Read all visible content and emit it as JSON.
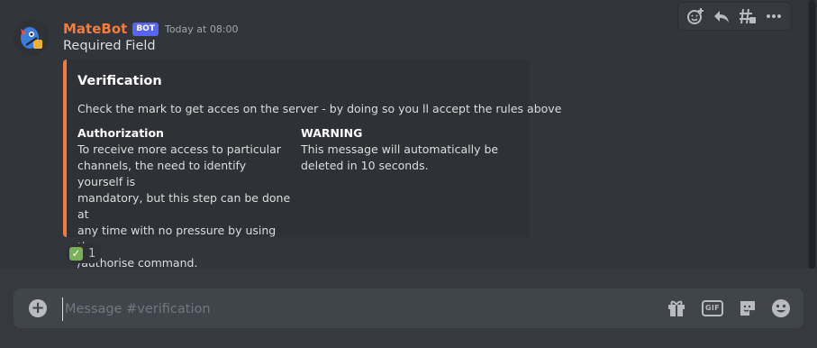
{
  "message": {
    "author": "MateBot",
    "bot_tag": "BOT",
    "timestamp": "Today at 08:00",
    "content": "Required Field"
  },
  "embed": {
    "accent_color": "#f47b3b",
    "title": "Verification",
    "description": "Check the mark to get acces on the server - by doing so you ll accept the rules above",
    "fields": [
      {
        "name": "Authorization",
        "value_lines": [
          "To receive more access to particular",
          "channels, the need to identify yourself is",
          "mandatory, but this step can be done at",
          "any time with no pressure by using the",
          "/authorise command."
        ]
      },
      {
        "name": "WARNING",
        "value_lines": [
          "This message will automatically be",
          "deleted in 10 seconds."
        ]
      }
    ]
  },
  "reaction": {
    "emoji": "white-check-mark",
    "glyph": "✓",
    "count": "1"
  },
  "toolbar": {
    "icons": [
      "add-reaction-icon",
      "reply-icon",
      "create-thread-icon",
      "more-icon"
    ]
  },
  "composer": {
    "placeholder": "Message #verification",
    "icons": [
      "add-attachment-icon",
      "gift-icon",
      "gif-icon",
      "sticker-icon",
      "emoji-icon"
    ],
    "gif_label": "GIF"
  }
}
